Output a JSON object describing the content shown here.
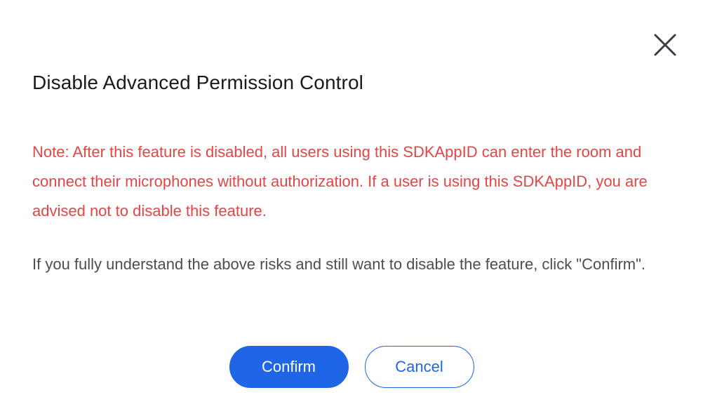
{
  "dialog": {
    "title": "Disable Advanced Permission Control",
    "close_icon": "close-icon",
    "warning_text": "Note: After this feature is disabled, all users using this SDKAppID can enter the room and connect their microphones without authorization. If a user is using this SDKAppID, you are advised not to disable this feature.",
    "info_text": "If you fully understand the above risks and still want to disable the feature, click \"Confirm\".",
    "confirm_label": "Confirm",
    "cancel_label": "Cancel"
  },
  "colors": {
    "warning": "#e54545",
    "primary": "#1e66e6",
    "text": "#4d4d4d",
    "title": "#1a1a1a"
  }
}
